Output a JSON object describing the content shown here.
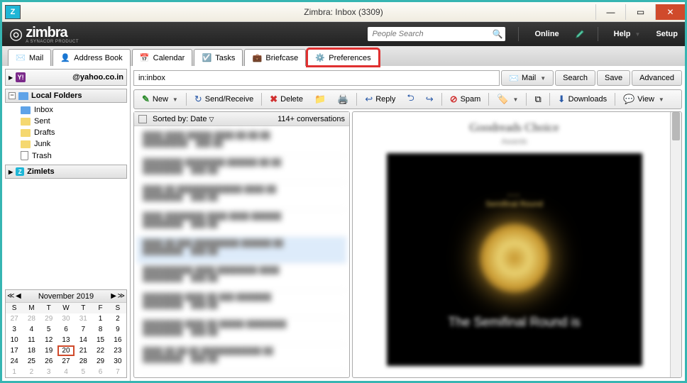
{
  "window": {
    "title": "Zimbra: Inbox (3309)",
    "appIcon": "Z"
  },
  "header": {
    "brand": "zimbra",
    "brandSub": "A SYNACOR PRODUCT",
    "searchPlaceholder": "People Search",
    "online": "Online",
    "help": "Help",
    "setup": "Setup"
  },
  "tabs": {
    "mail": "Mail",
    "addressBook": "Address Book",
    "calendar": "Calendar",
    "tasks": "Tasks",
    "briefcase": "Briefcase",
    "preferences": "Preferences"
  },
  "sidebar": {
    "account": "@yahoo.co.in",
    "localFoldersLabel": "Local Folders",
    "folders": {
      "inbox": "Inbox",
      "sent": "Sent",
      "drafts": "Drafts",
      "junk": "Junk",
      "trash": "Trash"
    },
    "zimletsLabel": "Zimlets"
  },
  "calendar": {
    "title": "November 2019",
    "dayHeaders": [
      "S",
      "M",
      "T",
      "W",
      "T",
      "F",
      "S"
    ],
    "weeks": [
      [
        "27",
        "28",
        "29",
        "30",
        "31",
        "1",
        "2"
      ],
      [
        "3",
        "4",
        "5",
        "6",
        "7",
        "8",
        "9"
      ],
      [
        "10",
        "11",
        "12",
        "13",
        "14",
        "15",
        "16"
      ],
      [
        "17",
        "18",
        "19",
        "20",
        "21",
        "22",
        "23"
      ],
      [
        "24",
        "25",
        "26",
        "27",
        "28",
        "29",
        "30"
      ],
      [
        "1",
        "2",
        "3",
        "4",
        "5",
        "6",
        "7"
      ]
    ],
    "today": "20",
    "grayStart": [
      "27",
      "28",
      "29",
      "30",
      "31"
    ],
    "grayEnd": [
      "1",
      "2",
      "3",
      "4",
      "5",
      "6",
      "7"
    ]
  },
  "searchRow": {
    "query": "in:inbox",
    "mailBtn": "Mail",
    "searchBtn": "Search",
    "saveBtn": "Save",
    "advancedBtn": "Advanced"
  },
  "toolbar": {
    "newBtn": "New",
    "sendReceive": "Send/Receive",
    "deleteBtn": "Delete",
    "reply": "Reply",
    "spam": "Spam",
    "downloads": "Downloads",
    "view": "View"
  },
  "msglist": {
    "sortLabel": "Sorted by: Date",
    "countLabel": "114+ conversations"
  },
  "preview": {
    "heading": "Goodreads Choice",
    "sub": "Awards",
    "caption": "The Semifinal Round is"
  }
}
